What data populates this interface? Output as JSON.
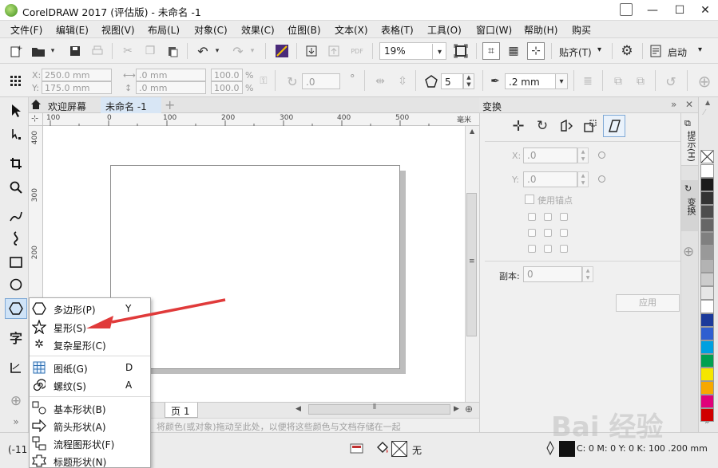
{
  "window": {
    "title": "CorelDRAW 2017 (评估版) - 未命名 -1",
    "minimize": "—",
    "maximize": "☐",
    "close": "✕"
  },
  "menu": [
    "文件(F)",
    "编辑(E)",
    "视图(V)",
    "布局(L)",
    "对象(C)",
    "效果(C)",
    "位图(B)",
    "文本(X)",
    "表格(T)",
    "工具(O)",
    "窗口(W)",
    "帮助(H)",
    "购买"
  ],
  "toolbar1": {
    "zoom": "19%",
    "snap_label": "贴齐(T)",
    "launch_label": "启动",
    "pdf_label": "PDF"
  },
  "toolbar2": {
    "x": "250.0 mm",
    "y": "175.0 mm",
    "x_label": "X:",
    "y_label": "Y:",
    "w": ".0 mm",
    "h": ".0 mm",
    "scale_w": "100.0",
    "scale_h": "100.0",
    "percent": "%",
    "angle": ".0",
    "degree": "°",
    "sides": "5",
    "outline": ".2 mm"
  },
  "doc_tabs": {
    "welcome": "欢迎屏幕",
    "doc": "未命名 -1",
    "add": "+"
  },
  "ruler": {
    "unit": "毫米",
    "h_ticks": [
      "100",
      "0",
      "100",
      "200",
      "300",
      "400",
      "500"
    ],
    "v_ticks": [
      "400",
      "300",
      "200"
    ]
  },
  "page_bar": {
    "page_tab": "页 1"
  },
  "color_hint": "将颜色(或对象)拖动至此处，以便将这些颜色与文档存储在一起",
  "status": {
    "coords": "(-11",
    "fill_none": "无",
    "outline_info": "C: 0 M: 0 Y: 0 K: 100  .200 mm"
  },
  "docker": {
    "title": "变换",
    "x_label": "X:",
    "x_value": ".0",
    "y_label": "Y:",
    "y_value": ".0",
    "use_anchor": "使用锚点",
    "copies_label": "副本:",
    "copies_value": "0",
    "apply": "应用",
    "close": "✕",
    "expand": "»"
  },
  "side_tabs": {
    "hints": "提示(H)",
    "transform": "变换"
  },
  "palette": [
    "#ffffff",
    "#1a1a1a",
    "#333333",
    "#4d4d4d",
    "#666666",
    "#808080",
    "#999999",
    "#b3b3b3",
    "#cccccc",
    "#e6e6e6",
    "#ffffff",
    "#1b3a9a",
    "#2f5fd0",
    "#00a0e0",
    "#00a050",
    "#f5e600",
    "#f7a800",
    "#e0007a",
    "#d00000"
  ],
  "flyout": {
    "items": [
      {
        "label": "多边形(P)",
        "key": "Y",
        "icon": "polygon-icon"
      },
      {
        "label": "星形(S)",
        "key": "",
        "icon": "star-icon"
      },
      {
        "label": "复杂星形(C)",
        "key": "",
        "icon": "complex-star-icon"
      },
      {
        "label": "图纸(G)",
        "key": "D",
        "icon": "graph-paper-icon"
      },
      {
        "label": "螺纹(S)",
        "key": "A",
        "icon": "spiral-icon"
      },
      {
        "label": "基本形状(B)",
        "key": "",
        "icon": "basic-shapes-icon"
      },
      {
        "label": "箭头形状(A)",
        "key": "",
        "icon": "arrow-shapes-icon"
      },
      {
        "label": "流程图形状(F)",
        "key": "",
        "icon": "flowchart-shapes-icon"
      },
      {
        "label": "标题形状(N)",
        "key": "",
        "icon": "banner-shapes-icon"
      }
    ]
  },
  "text_tool": "字",
  "watermark": "Bai 经验",
  "colors": {
    "annotation_arrow": "#e03a3a",
    "selected_tab": "#d8e6f5"
  }
}
